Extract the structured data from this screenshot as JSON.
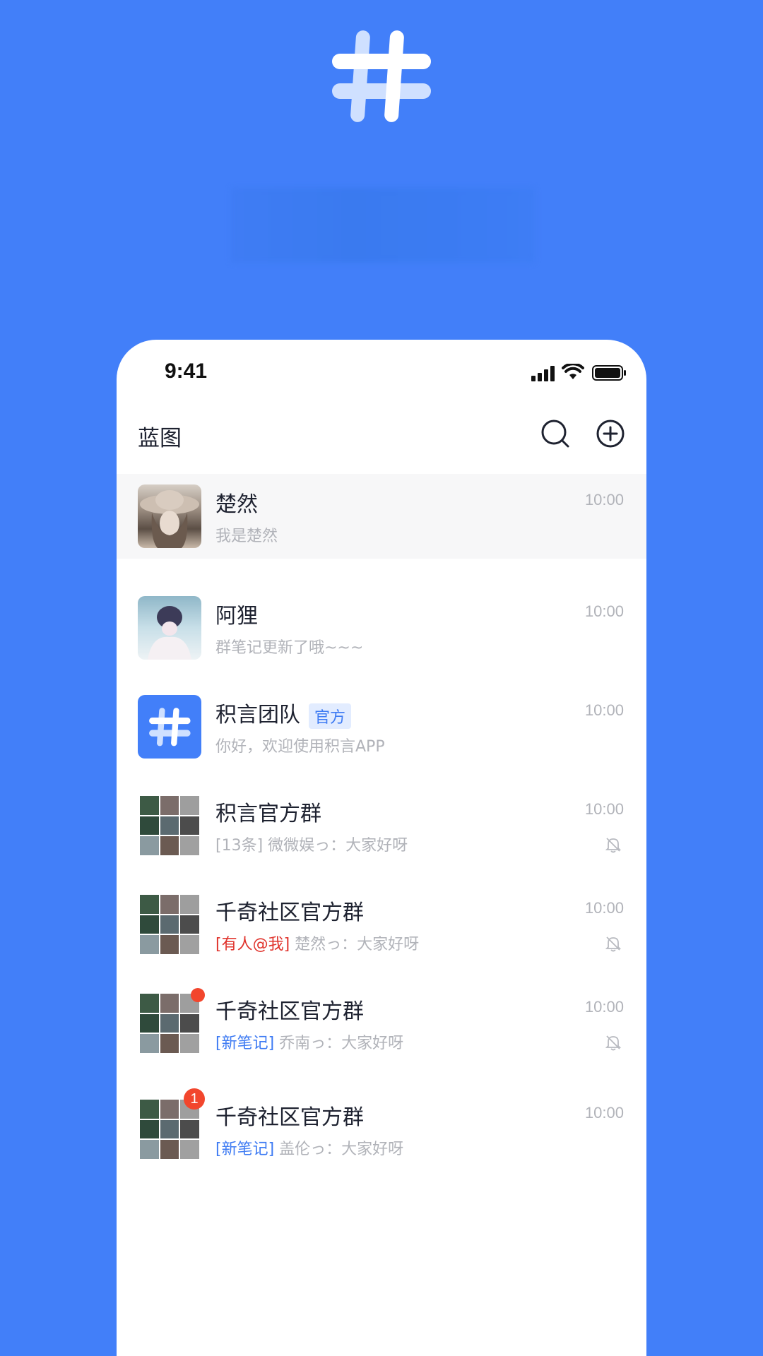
{
  "status": {
    "time": "9:41"
  },
  "nav": {
    "title": "蓝图"
  },
  "chats": [
    {
      "name": "楚然",
      "message": "我是楚然",
      "time": "10:00"
    },
    {
      "name": "阿狸",
      "message": "群笔记更新了哦~~~",
      "time": "10:00"
    },
    {
      "name": "积言团队",
      "tag": "官方",
      "message": "你好，欢迎使用积言APP",
      "time": "10:00"
    },
    {
      "name": "积言官方群",
      "prefix": "",
      "message": "[13条] 微微娱っ：大家好呀",
      "time": "10:00"
    },
    {
      "name": "千奇社区官方群",
      "prefix": "[有人@我]",
      "message": " 楚然っ：大家好呀",
      "time": "10:00"
    },
    {
      "name": "千奇社区官方群",
      "prefix": "[新笔记]",
      "message": " 乔南っ：大家好呀",
      "time": "10:00"
    },
    {
      "name": "千奇社区官方群",
      "prefix": "[新笔记]",
      "message": " 盖伦っ：大家好呀",
      "time": "10:00",
      "badge": "1"
    }
  ],
  "colors": {
    "brand": "#427ff9",
    "unread": "#f2462d",
    "accent_blue": "#3e7bf3",
    "mention_red": "#e0332c"
  }
}
